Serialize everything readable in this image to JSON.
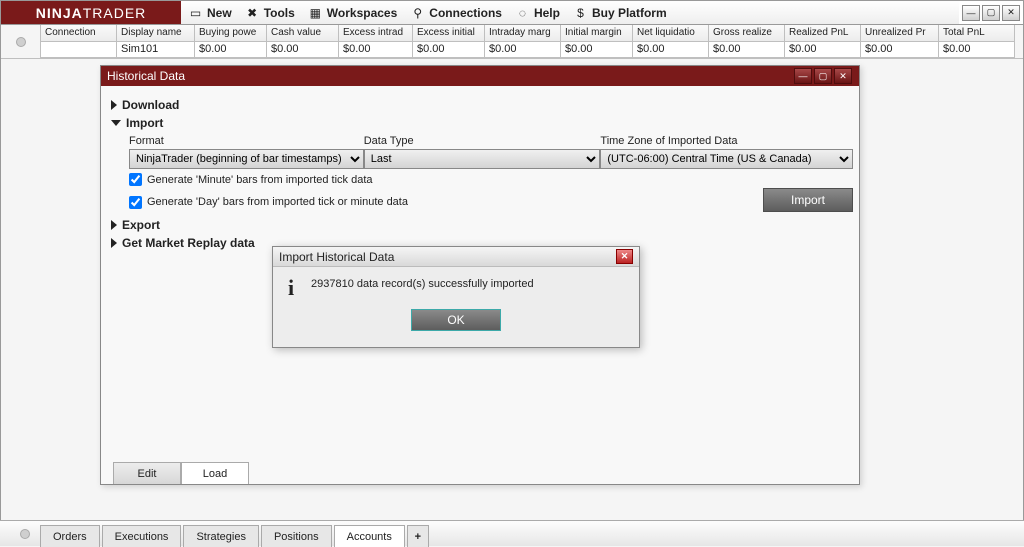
{
  "brand": {
    "a": "NINJA",
    "b": "TRADER"
  },
  "menu": {
    "new": "New",
    "tools": "Tools",
    "workspaces": "Workspaces",
    "connections": "Connections",
    "help": "Help",
    "buy": "Buy Platform"
  },
  "grid": {
    "headers": [
      "Connection",
      "Display name",
      "Buying powe",
      "Cash value",
      "Excess intrad",
      "Excess initial",
      "Intraday marg",
      "Initial margin",
      "Net liquidatio",
      "Gross realize",
      "Realized PnL",
      "Unrealized Pr",
      "Total PnL"
    ],
    "row": [
      "",
      "Sim101",
      "$0.00",
      "$0.00",
      "$0.00",
      "$0.00",
      "$0.00",
      "$0.00",
      "$0.00",
      "$0.00",
      "$0.00",
      "$0.00",
      "$0.00"
    ]
  },
  "hd": {
    "title": "Historical Data",
    "nav": {
      "download": "Download",
      "import": "Import",
      "export": "Export",
      "replay": "Get Market Replay data"
    },
    "form": {
      "format_label": "Format",
      "format_value": "NinjaTrader (beginning of bar timestamps)",
      "datatype_label": "Data Type",
      "datatype_value": "Last",
      "tz_label": "Time Zone of Imported Data",
      "tz_value": "(UTC-06:00) Central Time (US & Canada)",
      "chk1": "Generate 'Minute' bars from imported tick data",
      "chk2": "Generate 'Day' bars from imported tick or minute data",
      "import_btn": "Import"
    },
    "tabs": {
      "edit": "Edit",
      "load": "Load"
    }
  },
  "msg": {
    "title": "Import Historical Data",
    "text": "2937810 data record(s) successfully imported",
    "ok": "OK"
  },
  "footer": {
    "orders": "Orders",
    "executions": "Executions",
    "strategies": "Strategies",
    "positions": "Positions",
    "accounts": "Accounts",
    "plus": "+"
  }
}
